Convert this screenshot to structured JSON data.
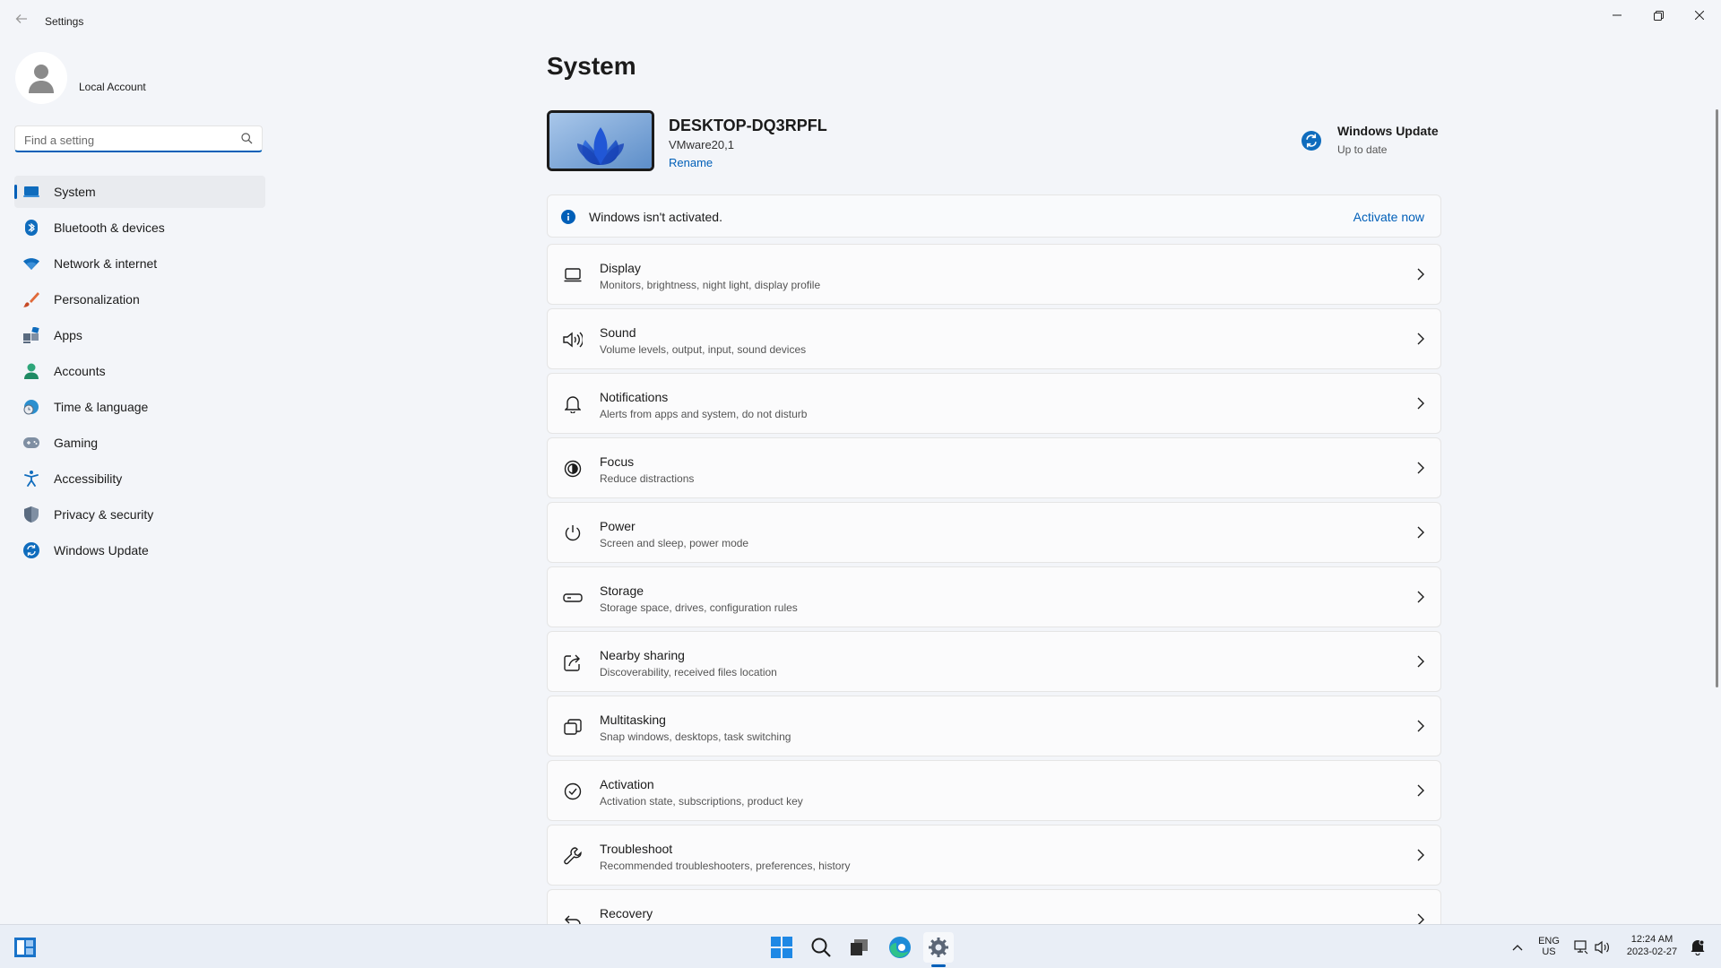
{
  "window": {
    "title": "Settings"
  },
  "account": {
    "name": "Local Account"
  },
  "search": {
    "placeholder": "Find a setting"
  },
  "nav": {
    "items": [
      {
        "label": "System",
        "icon": "laptop-icon",
        "active": true
      },
      {
        "label": "Bluetooth & devices",
        "icon": "bluetooth-icon"
      },
      {
        "label": "Network & internet",
        "icon": "wifi-icon"
      },
      {
        "label": "Personalization",
        "icon": "brush-icon"
      },
      {
        "label": "Apps",
        "icon": "apps-icon"
      },
      {
        "label": "Accounts",
        "icon": "person-icon"
      },
      {
        "label": "Time & language",
        "icon": "globe-clock-icon"
      },
      {
        "label": "Gaming",
        "icon": "gamepad-icon"
      },
      {
        "label": "Accessibility",
        "icon": "accessibility-icon"
      },
      {
        "label": "Privacy & security",
        "icon": "shield-icon"
      },
      {
        "label": "Windows Update",
        "icon": "sync-icon"
      }
    ]
  },
  "main": {
    "title": "System",
    "device": {
      "name": "DESKTOP-DQ3RPFL",
      "model": "VMware20,1",
      "rename": "Rename"
    },
    "windows_update": {
      "title": "Windows Update",
      "status": "Up to date"
    },
    "activation": {
      "message": "Windows isn't activated.",
      "action": "Activate now"
    },
    "settings": [
      {
        "title": "Display",
        "desc": "Monitors, brightness, night light, display profile",
        "icon": "monitor-icon"
      },
      {
        "title": "Sound",
        "desc": "Volume levels, output, input, sound devices",
        "icon": "speaker-icon"
      },
      {
        "title": "Notifications",
        "desc": "Alerts from apps and system, do not disturb",
        "icon": "bell-icon"
      },
      {
        "title": "Focus",
        "desc": "Reduce distractions",
        "icon": "focus-icon"
      },
      {
        "title": "Power",
        "desc": "Screen and sleep, power mode",
        "icon": "power-icon"
      },
      {
        "title": "Storage",
        "desc": "Storage space, drives, configuration rules",
        "icon": "drive-icon"
      },
      {
        "title": "Nearby sharing",
        "desc": "Discoverability, received files location",
        "icon": "share-icon"
      },
      {
        "title": "Multitasking",
        "desc": "Snap windows, desktops, task switching",
        "icon": "multitask-icon"
      },
      {
        "title": "Activation",
        "desc": "Activation state, subscriptions, product key",
        "icon": "check-circle-icon"
      },
      {
        "title": "Troubleshoot",
        "desc": "Recommended troubleshooters, preferences, history",
        "icon": "wrench-icon"
      },
      {
        "title": "Recovery",
        "desc": "",
        "icon": "recovery-icon"
      }
    ]
  },
  "taskbar": {
    "lang_top": "ENG",
    "lang_bottom": "US",
    "time": "12:24 AM",
    "date": "2023-02-27"
  },
  "colors": {
    "accent": "#005fb8",
    "background": "#f3f5f9"
  }
}
